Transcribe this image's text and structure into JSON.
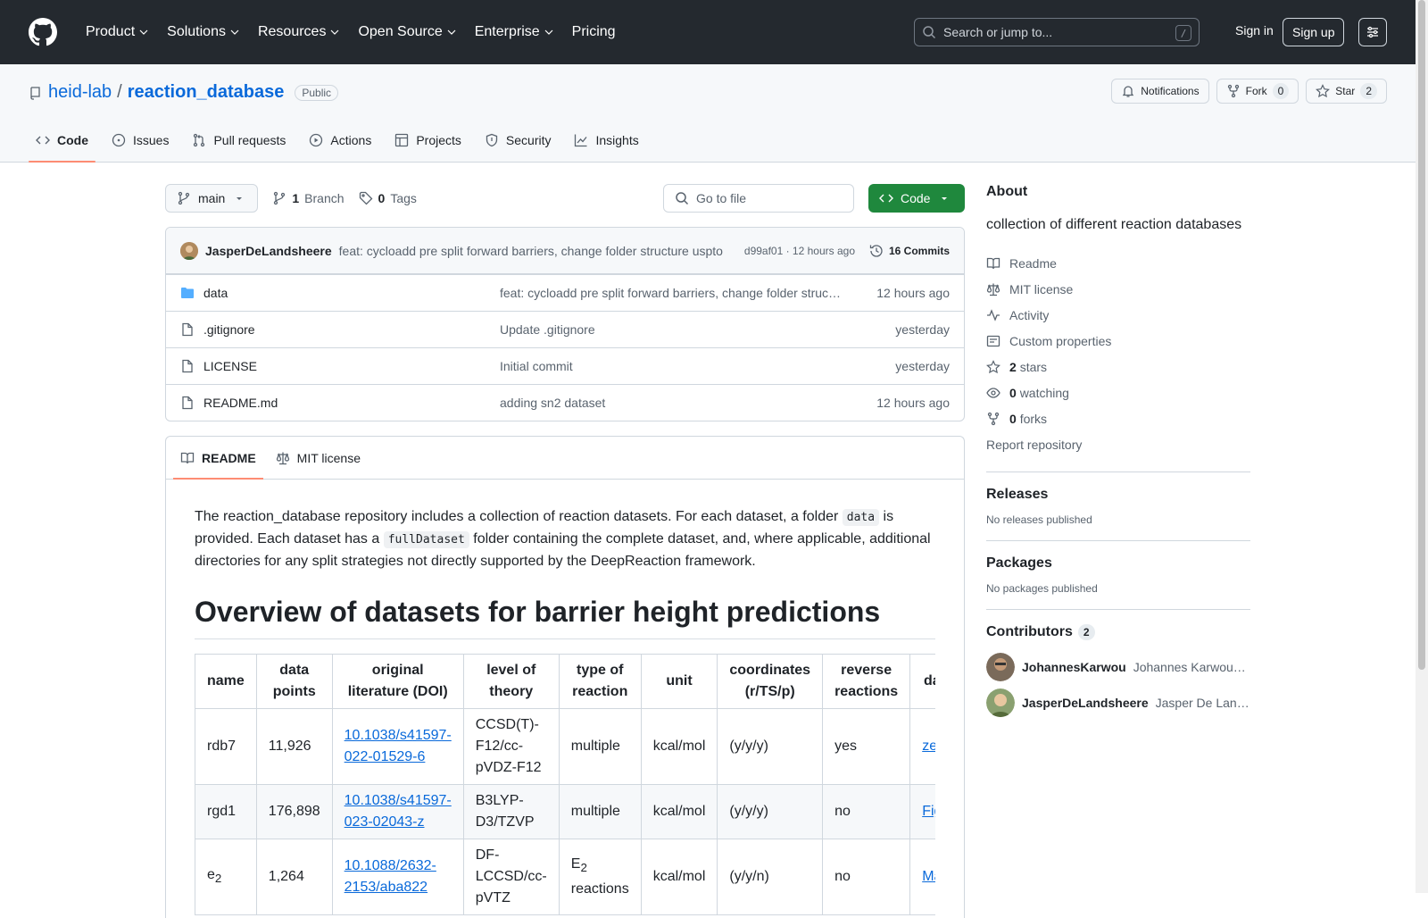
{
  "header": {
    "nav": [
      "Product",
      "Solutions",
      "Resources",
      "Open Source",
      "Enterprise",
      "Pricing"
    ],
    "search_placeholder": "Search or jump to...",
    "search_shortcut": "/",
    "signin": "Sign in",
    "signup": "Sign up"
  },
  "repo": {
    "owner": "heid-lab",
    "separator": "/",
    "name": "reaction_database",
    "visibility": "Public",
    "notifications": "Notifications",
    "fork": "Fork",
    "fork_count": "0",
    "star": "Star",
    "star_count": "2",
    "tabs": [
      "Code",
      "Issues",
      "Pull requests",
      "Actions",
      "Projects",
      "Security",
      "Insights"
    ]
  },
  "bar": {
    "branch": "main",
    "branch_count": "1",
    "branch_label": "Branch",
    "tag_count": "0",
    "tag_label": "Tags",
    "goto_placeholder": "Go to file",
    "code_button": "Code"
  },
  "commit": {
    "author": "JasperDeLandsheere",
    "message": "feat: cycloadd pre split forward barriers, change folder structure uspto",
    "hash_time": "d99af01 · 12 hours ago",
    "count": "16 Commits"
  },
  "files": [
    {
      "name": "data",
      "type": "folder",
      "message": "feat: cycloadd pre split forward barriers, change folder struc…",
      "time": "12 hours ago"
    },
    {
      "name": ".gitignore",
      "type": "file",
      "message": "Update .gitignore",
      "time": "yesterday"
    },
    {
      "name": "LICENSE",
      "type": "file",
      "message": "Initial commit",
      "time": "yesterday"
    },
    {
      "name": "README.md",
      "type": "file",
      "message": "adding sn2 dataset",
      "time": "12 hours ago"
    }
  ],
  "readme": {
    "tabs": [
      "README",
      "MIT license"
    ],
    "intro_1": "The reaction_database repository includes a collection of reaction datasets. For each dataset, a folder ",
    "code_1": "data",
    "intro_2": " is provided. Each dataset has a ",
    "code_2": "fullDataset",
    "intro_3": " folder containing the complete dataset, and, where applicable, additional directories for any split strategies not directly supported by the DeepReaction framework.",
    "heading": "Overview of datasets for barrier height predictions",
    "table": {
      "headers": [
        "name",
        "data points",
        "original literature (DOI)",
        "level of theory",
        "type of reaction",
        "unit",
        "coordinates (r/TS/p)",
        "reverse reactions",
        "da"
      ],
      "rows": [
        {
          "name": "rdb7",
          "points": "11,926",
          "doi": "10.1038/s41597-022-01529-6",
          "theory": "CCSD(T)-F12/cc-pVDZ-F12",
          "type": "multiple",
          "unit": "kcal/mol",
          "coords": "(y/y/y)",
          "reverse": "yes",
          "link": "ze"
        },
        {
          "name": "rgd1",
          "points": "176,898",
          "doi": "10.1038/s41597-023-02043-z",
          "theory": "B3LYP-D3/TZVP",
          "type": "multiple",
          "unit": "kcal/mol",
          "coords": "(y/y/y)",
          "reverse": "no",
          "link": "Fig"
        },
        {
          "name": "e",
          "name_sub": "2",
          "points": "1,264",
          "doi": "10.1088/2632-2153/aba822",
          "theory": "DF-LCCSD/cc-pVTZ",
          "type": "E",
          "type_sub": "2",
          "type_rest": " reactions",
          "unit": "kcal/mol",
          "coords": "(y/y/n)",
          "reverse": "no",
          "link": "Ma"
        }
      ]
    }
  },
  "sidebar": {
    "about_title": "About",
    "description": "collection of different reaction databases",
    "items": [
      {
        "icon": "book-icon",
        "label": "Readme",
        "count": ""
      },
      {
        "icon": "scale-icon",
        "label": "MIT license",
        "count": ""
      },
      {
        "icon": "pulse-icon",
        "label": "Activity",
        "count": ""
      },
      {
        "icon": "note-icon",
        "label": "Custom properties",
        "count": ""
      },
      {
        "icon": "star-icon",
        "label": "stars",
        "count": "2"
      },
      {
        "icon": "eye-icon",
        "label": "watching",
        "count": "0"
      },
      {
        "icon": "fork-icon",
        "label": "forks",
        "count": "0"
      }
    ],
    "report": "Report repository",
    "releases_title": "Releases",
    "releases_empty": "No releases published",
    "packages_title": "Packages",
    "packages_empty": "No packages published",
    "contributors_title": "Contributors",
    "contributors_count": "2",
    "contributors": [
      {
        "login": "JohannesKarwou",
        "name": "Johannes Karwoun…"
      },
      {
        "login": "JasperDeLandsheere",
        "name": "Jasper De Lan…"
      }
    ]
  }
}
